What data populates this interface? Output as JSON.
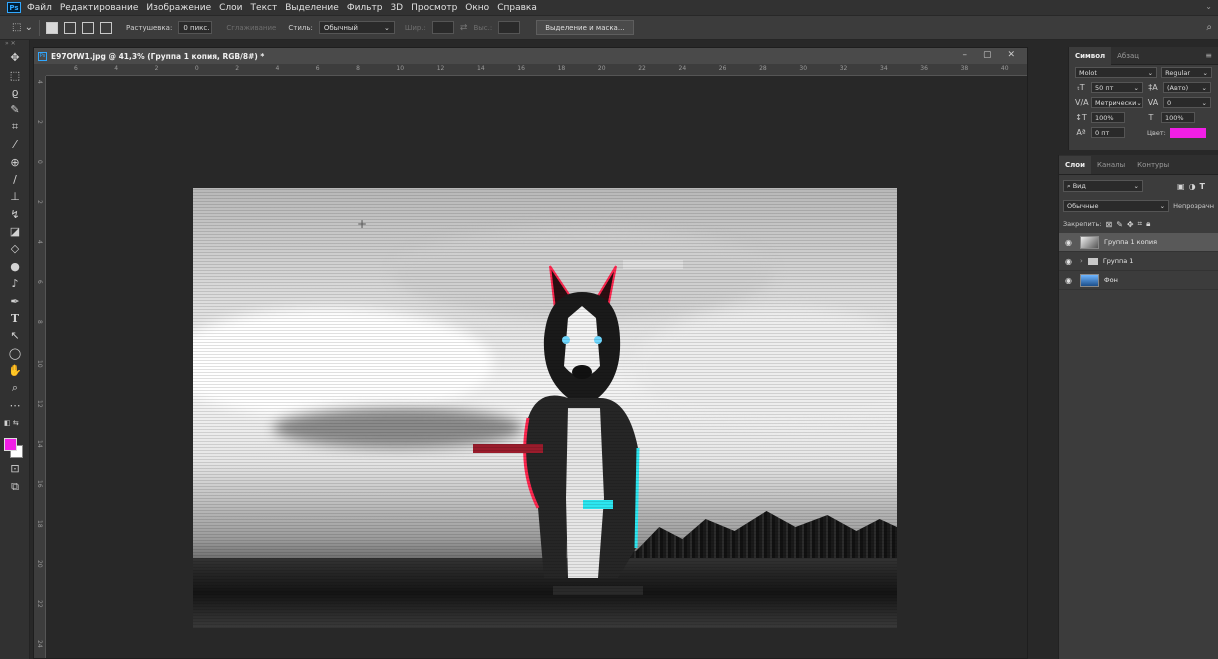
{
  "app": {
    "logo": "Ps",
    "menu": [
      "Файл",
      "Редактирование",
      "Изображение",
      "Слои",
      "Текст",
      "Выделение",
      "Фильтр",
      "3D",
      "Просмотр",
      "Окно",
      "Справка"
    ]
  },
  "options": {
    "feather_label": "Растушевка:",
    "feather_value": "0 пикс.",
    "antialias_label": "Сглаживание",
    "style_label": "Стиль:",
    "style_value": "Обычный",
    "width_label": "Шир.:",
    "height_label": "Выс.:",
    "select_mask_button": "Выделение и маска..."
  },
  "document": {
    "title": "E97OfW1.jpg @ 41,3% (Группа 1 копия, RGB/8#) *",
    "ruler_h_labels": [
      "6",
      "4",
      "2",
      "0",
      "2",
      "4",
      "6",
      "8",
      "10",
      "12",
      "14",
      "16",
      "18",
      "20",
      "22",
      "24",
      "26",
      "28",
      "30",
      "32",
      "34",
      "36",
      "38",
      "40"
    ],
    "ruler_v_labels": [
      "4",
      "2",
      "0",
      "2",
      "4",
      "6",
      "8",
      "1\n0",
      "1\n2",
      "1\n4",
      "1\n6",
      "1\n8",
      "2\n0",
      "2\n2",
      "2\n4"
    ]
  },
  "character_panel": {
    "tabs": [
      "Символ",
      "Абзац"
    ],
    "font_family": "Molot",
    "font_style": "Regular",
    "size": "50 пт",
    "leading": "(Авто)",
    "kerning": "Метрически",
    "tracking": "0",
    "vscale": "100%",
    "hscale": "100%",
    "baseline": "0 пт",
    "color_label": "Цвет:",
    "color": "#f11fe6"
  },
  "layers_panel": {
    "tabs": [
      "Слои",
      "Каналы",
      "Контуры"
    ],
    "filter_label": "Вид",
    "blend_mode": "Обычные",
    "opacity_label": "Непрозрачн",
    "lock_label": "Закрепить:",
    "layers": [
      {
        "name": "Группа 1 копия",
        "type": "image",
        "selected": true
      },
      {
        "name": "Группа 1",
        "type": "group",
        "selected": false
      },
      {
        "name": "Фон",
        "type": "image",
        "selected": false
      }
    ]
  },
  "colors": {
    "foreground": "#f11fe6",
    "background": "#ffffff",
    "accent": "#31a8ff"
  }
}
